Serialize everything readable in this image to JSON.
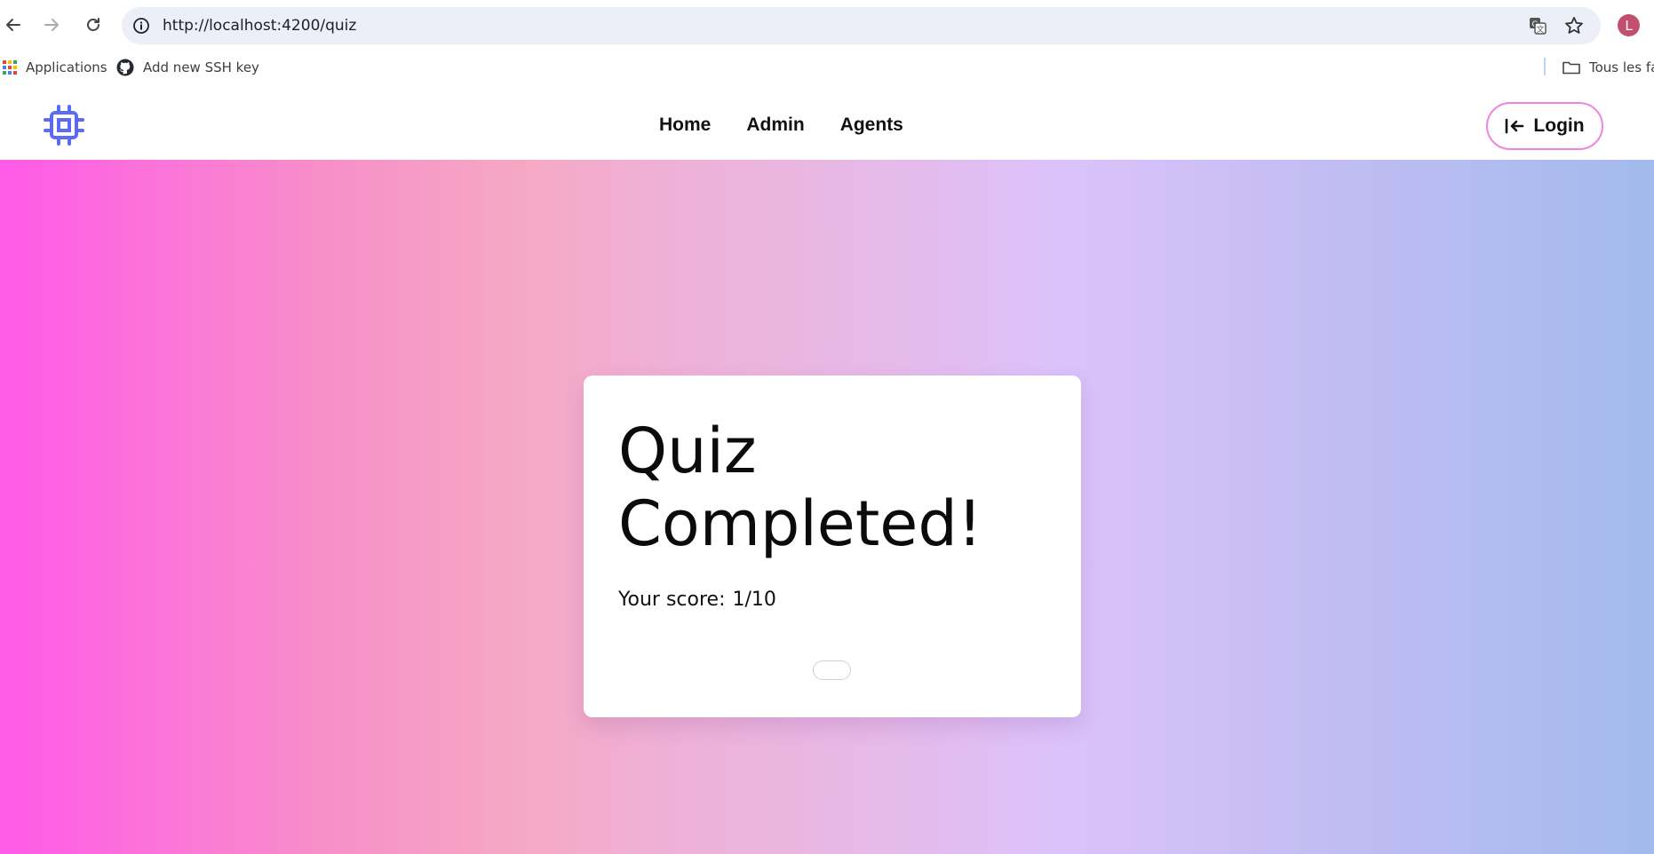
{
  "browser": {
    "url": "http://localhost:4200/quiz",
    "profile_initial": "L",
    "icons": {
      "back": "arrow-left-icon",
      "forward": "arrow-right-icon",
      "reload": "reload-icon",
      "site_info": "info-icon",
      "translate": "translate-icon",
      "bookmark": "star-icon"
    }
  },
  "bookmarks": {
    "items": [
      {
        "label": "Applications",
        "icon": "apps-grid-icon"
      },
      {
        "label": "Add new SSH key",
        "icon": "github-icon"
      }
    ],
    "folder": {
      "label": "Tous les fav",
      "icon": "folder-icon"
    }
  },
  "header": {
    "logo_icon": "cpu-chip-icon",
    "nav": [
      "Home",
      "Admin",
      "Agents"
    ],
    "login_label": "Login",
    "login_icon": "login-arrow-icon"
  },
  "quiz": {
    "title": "Quiz Completed!",
    "score_label": "Your score:",
    "score_value": "1/10"
  },
  "colors": {
    "accent": "#5b6cf0",
    "login_border": "#ef84df",
    "gradient": [
      "#ff5ae8",
      "#f5a9c4",
      "#dcc2fb",
      "#a2baed"
    ]
  }
}
